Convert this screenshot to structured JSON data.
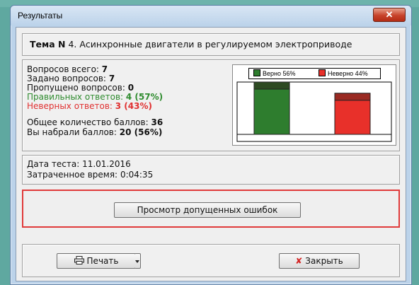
{
  "window": {
    "title": "Результаты",
    "close_glyph": "✕"
  },
  "topic": {
    "prefix": "Тема N",
    "text": " 4. Асинхронные двигатели в регулируемом электроприводе"
  },
  "stats": {
    "total_label": "Вопросов всего:",
    "total_value": "7",
    "asked_label": "Задано вопросов:",
    "asked_value": "7",
    "skipped_label": "Пропущено вопросов:",
    "skipped_value": "0",
    "correct_label": "Правильных ответов:",
    "correct_value": "4 (57%)",
    "wrong_label": "Неверных ответов:",
    "wrong_value": "3 (43%)",
    "max_label": "Общее количество баллов:",
    "max_value": "36",
    "scored_label": "Вы набрали баллов:",
    "scored_value": "20 (56%)"
  },
  "chart_data": {
    "type": "bar",
    "series": [
      {
        "name": "Верно 56%",
        "value": 56,
        "color": "#2e7d2e",
        "top_color": "#2d4a22"
      },
      {
        "name": "Неверно 44%",
        "value": 44,
        "color": "#e8302a",
        "top_color": "#9a2a22"
      }
    ],
    "legend": "top"
  },
  "dates": {
    "date_label": "Дата теста:",
    "date_value": "11.01.2016",
    "time_label": "Затраченное время:",
    "time_value": "0:04:35"
  },
  "buttons": {
    "review": "Просмотр допущенных ошибок",
    "print": "Печать",
    "close": "Закрыть",
    "print_icon": "printer-icon",
    "close_icon": "x-icon"
  }
}
